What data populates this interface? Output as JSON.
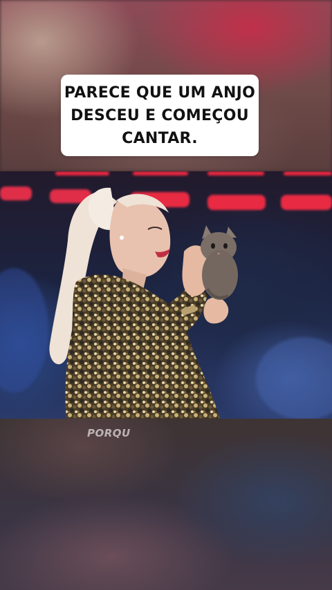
{
  "caption": {
    "lines": [
      "PARECE QUE UM ANJO",
      "DESCEU E COMEÇOU",
      "CANTAR."
    ]
  },
  "watermark": {
    "text": "PORQU"
  },
  "scene": {
    "subject": "blonde-woman-holding-kitten",
    "colors": {
      "stage_lights": "#e8253f",
      "background_blue": "#2a4a8a",
      "hair": "#efe2d6",
      "sequin_jacket": "#5a4a2e",
      "kitten": "#7b6e66",
      "caption_bg": "#ffffff",
      "caption_text": "#111111"
    }
  }
}
